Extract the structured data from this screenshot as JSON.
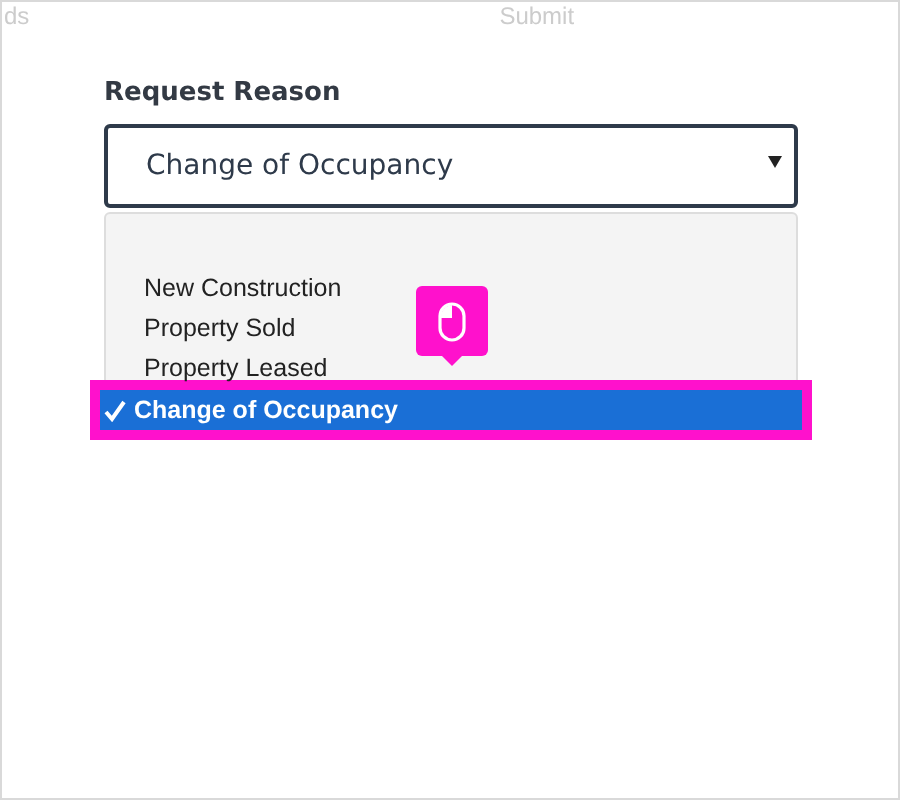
{
  "top_links": [
    "ds",
    "Submit"
  ],
  "field": {
    "label": "Request Reason",
    "value": "Change of Occupancy"
  },
  "options": [
    {
      "label": "New Construction",
      "selected": false
    },
    {
      "label": "Property Sold",
      "selected": false
    },
    {
      "label": "Property Leased",
      "selected": false
    },
    {
      "label": "Change of Occupancy",
      "selected": true
    }
  ]
}
